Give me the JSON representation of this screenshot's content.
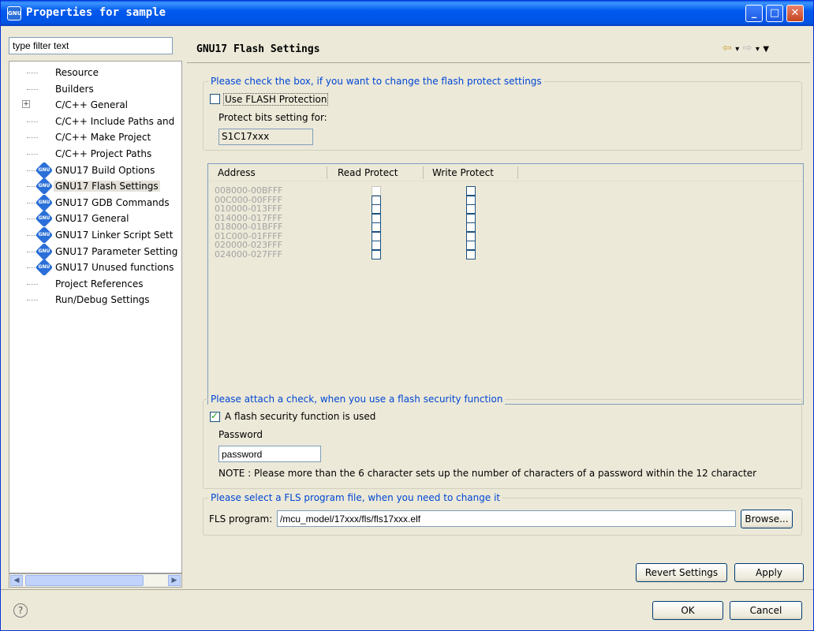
{
  "window": {
    "title": "Properties for sample"
  },
  "sidebar": {
    "filter_placeholder": "type filter text",
    "items": [
      {
        "label": "Resource",
        "icon": "none",
        "expandable": false
      },
      {
        "label": "Builders",
        "icon": "none",
        "expandable": false
      },
      {
        "label": "C/C++ General",
        "icon": "none",
        "expandable": true
      },
      {
        "label": "C/C++ Include Paths and",
        "icon": "none",
        "expandable": false
      },
      {
        "label": "C/C++ Make Project",
        "icon": "none",
        "expandable": false
      },
      {
        "label": "C/C++ Project Paths",
        "icon": "none",
        "expandable": false
      },
      {
        "label": "GNU17 Build Options",
        "icon": "gnu-icon",
        "expandable": false
      },
      {
        "label": "GNU17 Flash Settings",
        "icon": "gnu-icon",
        "expandable": false,
        "selected": true
      },
      {
        "label": "GNU17 GDB Commands",
        "icon": "gnu-icon",
        "expandable": false
      },
      {
        "label": "GNU17 General",
        "icon": "gnu-icon",
        "expandable": false
      },
      {
        "label": "GNU17 Linker Script Sett",
        "icon": "gnu-icon",
        "expandable": false
      },
      {
        "label": "GNU17 Parameter Setting",
        "icon": "gnu-icon",
        "expandable": false
      },
      {
        "label": "GNU17 Unused functions",
        "icon": "gnu-icon",
        "expandable": false
      },
      {
        "label": "Project References",
        "icon": "none",
        "expandable": false
      },
      {
        "label": "Run/Debug Settings",
        "icon": "none",
        "expandable": false
      }
    ]
  },
  "page": {
    "title": "GNU17 Flash Settings",
    "protect_group": {
      "legend": "Please check the box, if you want to change the flash protect settings",
      "use_flash_label": "Use FLASH Protection",
      "use_flash_checked": false,
      "protect_bits_label": "Protect bits setting for:",
      "protect_bits_value": "S1C17xxx"
    },
    "table": {
      "columns": [
        "Address",
        "Read Protect",
        "Write Protect"
      ],
      "rows": [
        {
          "address": "008000-00BFFF",
          "read": false,
          "write": false
        },
        {
          "address": "00C000-00FFFF",
          "read": false,
          "write": false
        },
        {
          "address": "010000-013FFF",
          "read": false,
          "write": false
        },
        {
          "address": "014000-017FFF",
          "read": false,
          "write": false
        },
        {
          "address": "018000-01BFFF",
          "read": false,
          "write": false
        },
        {
          "address": "01C000-01FFFF",
          "read": false,
          "write": false
        },
        {
          "address": "020000-023FFF",
          "read": false,
          "write": false
        },
        {
          "address": "024000-027FFF",
          "read": false,
          "write": false
        }
      ]
    },
    "security_group": {
      "legend": "Please attach a check, when you use a flash security function",
      "used_label": "A flash security function is used",
      "used_checked": true,
      "password_label": "Password",
      "password_value": "password",
      "note": "NOTE : Please more than the 6 character sets up the number of characters of a password within the 12 character"
    },
    "fls_group": {
      "legend": "Please select a FLS program file, when you need to change it",
      "label": "FLS program:",
      "value": "/mcu_model/17xxx/fls/fls17xxx.elf",
      "browse_label": "Browse..."
    },
    "revert_label": "Revert Settings",
    "apply_label": "Apply"
  },
  "footer": {
    "ok_label": "OK",
    "cancel_label": "Cancel"
  }
}
